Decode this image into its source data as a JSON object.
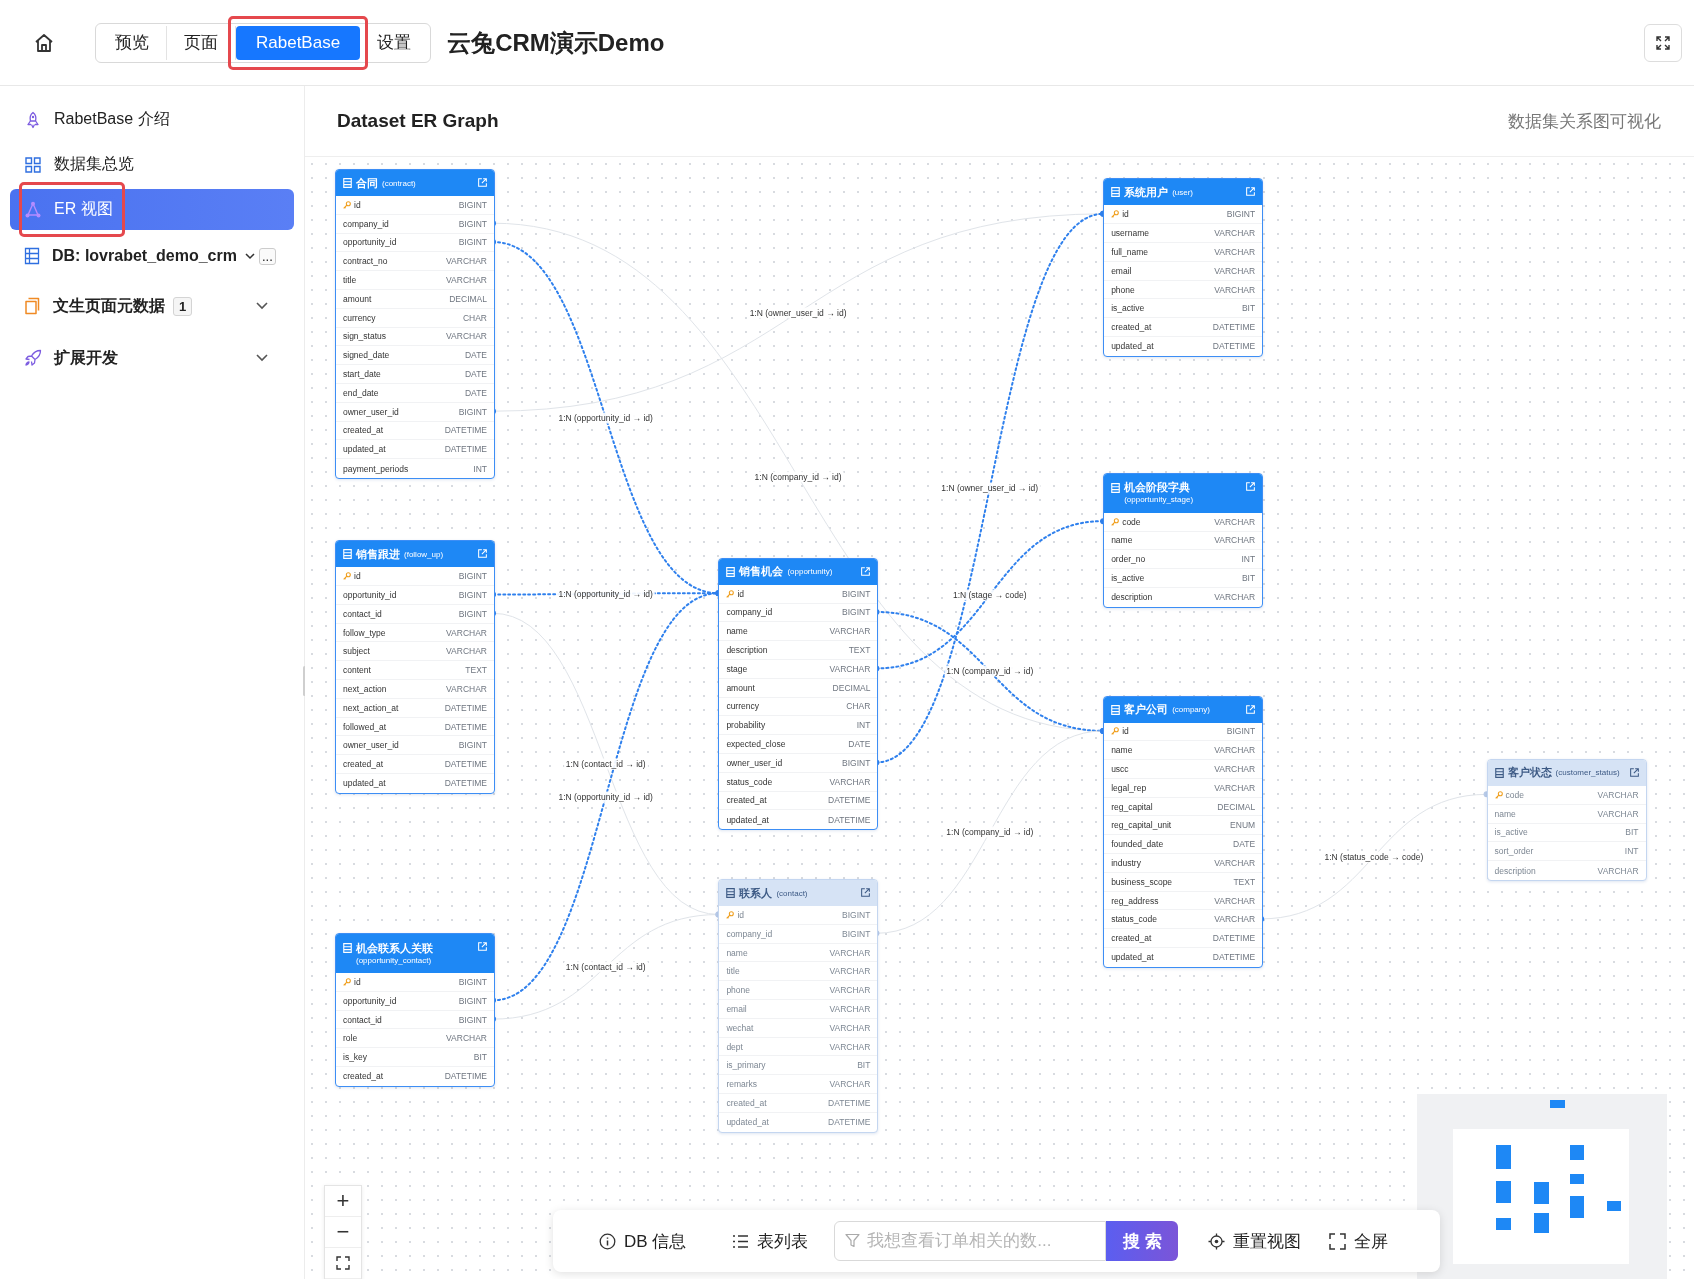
{
  "topbar": {
    "tabs": [
      {
        "label": "预览",
        "selected": false,
        "annotated": false
      },
      {
        "label": "页面",
        "selected": false,
        "annotated": false
      },
      {
        "label": "RabetBase",
        "selected": true,
        "annotated": true
      },
      {
        "label": "设置",
        "selected": false,
        "annotated": false
      }
    ],
    "title": "云兔CRM演示Demo"
  },
  "sidebar": {
    "items": [
      {
        "kind": "link",
        "label": "RabetBase 介绍",
        "selected": false,
        "annotated": false
      },
      {
        "kind": "link",
        "label": "数据集总览",
        "selected": false,
        "annotated": false
      },
      {
        "kind": "link",
        "label": "ER 视图",
        "selected": true,
        "annotated": true
      },
      {
        "kind": "db",
        "label": "DB: lovrabet_demo_crm",
        "more": "..."
      },
      {
        "kind": "group",
        "label": "文生页面元数据",
        "badge": "1",
        "expanded": false
      },
      {
        "kind": "group",
        "label": "扩展开发",
        "expanded": false
      }
    ]
  },
  "panel": {
    "title": "Dataset ER Graph",
    "subtitle": "数据集关系图可视化"
  },
  "tables": [
    {
      "title": "合同",
      "name": "(contract)",
      "faded": false,
      "fields": [
        {
          "name": "id",
          "type": "BIGINT",
          "pk": true
        },
        {
          "name": "company_id",
          "type": "BIGINT",
          "pk": false
        },
        {
          "name": "opportunity_id",
          "type": "BIGINT",
          "pk": false
        },
        {
          "name": "contract_no",
          "type": "VARCHAR",
          "pk": false
        },
        {
          "name": "title",
          "type": "VARCHAR",
          "pk": false
        },
        {
          "name": "amount",
          "type": "DECIMAL",
          "pk": false
        },
        {
          "name": "currency",
          "type": "CHAR",
          "pk": false
        },
        {
          "name": "sign_status",
          "type": "VARCHAR",
          "pk": false
        },
        {
          "name": "signed_date",
          "type": "DATE",
          "pk": false
        },
        {
          "name": "start_date",
          "type": "DATE",
          "pk": false
        },
        {
          "name": "end_date",
          "type": "DATE",
          "pk": false
        },
        {
          "name": "owner_user_id",
          "type": "BIGINT",
          "pk": false
        },
        {
          "name": "created_at",
          "type": "DATETIME",
          "pk": false
        },
        {
          "name": "updated_at",
          "type": "DATETIME",
          "pk": false
        },
        {
          "name": "payment_periods",
          "type": "INT",
          "pk": false
        }
      ]
    },
    {
      "title": "销售跟进",
      "name": "(follow_up)",
      "faded": false,
      "fields": [
        {
          "name": "id",
          "type": "BIGINT",
          "pk": true
        },
        {
          "name": "opportunity_id",
          "type": "BIGINT",
          "pk": false
        },
        {
          "name": "contact_id",
          "type": "BIGINT",
          "pk": false
        },
        {
          "name": "follow_type",
          "type": "VARCHAR",
          "pk": false
        },
        {
          "name": "subject",
          "type": "VARCHAR",
          "pk": false
        },
        {
          "name": "content",
          "type": "TEXT",
          "pk": false
        },
        {
          "name": "next_action",
          "type": "VARCHAR",
          "pk": false
        },
        {
          "name": "next_action_at",
          "type": "DATETIME",
          "pk": false
        },
        {
          "name": "followed_at",
          "type": "DATETIME",
          "pk": false
        },
        {
          "name": "owner_user_id",
          "type": "BIGINT",
          "pk": false
        },
        {
          "name": "created_at",
          "type": "DATETIME",
          "pk": false
        },
        {
          "name": "updated_at",
          "type": "DATETIME",
          "pk": false
        }
      ]
    },
    {
      "title": "机会联系人关联",
      "name": "(opportunity_contact)",
      "faded": false,
      "fields": [
        {
          "name": "id",
          "type": "BIGINT",
          "pk": true
        },
        {
          "name": "opportunity_id",
          "type": "BIGINT",
          "pk": false
        },
        {
          "name": "contact_id",
          "type": "BIGINT",
          "pk": false
        },
        {
          "name": "role",
          "type": "VARCHAR",
          "pk": false
        },
        {
          "name": "is_key",
          "type": "BIT",
          "pk": false
        },
        {
          "name": "created_at",
          "type": "DATETIME",
          "pk": false
        }
      ]
    },
    {
      "title": "销售机会",
      "name": "(opportunity)",
      "faded": false,
      "fields": [
        {
          "name": "id",
          "type": "BIGINT",
          "pk": true
        },
        {
          "name": "company_id",
          "type": "BIGINT",
          "pk": false
        },
        {
          "name": "name",
          "type": "VARCHAR",
          "pk": false
        },
        {
          "name": "description",
          "type": "TEXT",
          "pk": false
        },
        {
          "name": "stage",
          "type": "VARCHAR",
          "pk": false
        },
        {
          "name": "amount",
          "type": "DECIMAL",
          "pk": false
        },
        {
          "name": "currency",
          "type": "CHAR",
          "pk": false
        },
        {
          "name": "probability",
          "type": "INT",
          "pk": false
        },
        {
          "name": "expected_close",
          "type": "DATE",
          "pk": false
        },
        {
          "name": "owner_user_id",
          "type": "BIGINT",
          "pk": false
        },
        {
          "name": "status_code",
          "type": "VARCHAR",
          "pk": false
        },
        {
          "name": "created_at",
          "type": "DATETIME",
          "pk": false
        },
        {
          "name": "updated_at",
          "type": "DATETIME",
          "pk": false
        }
      ]
    },
    {
      "title": "联系人",
      "name": "(contact)",
      "faded": true,
      "fields": [
        {
          "name": "id",
          "type": "BIGINT",
          "pk": true
        },
        {
          "name": "company_id",
          "type": "BIGINT",
          "pk": false
        },
        {
          "name": "name",
          "type": "VARCHAR",
          "pk": false
        },
        {
          "name": "title",
          "type": "VARCHAR",
          "pk": false
        },
        {
          "name": "phone",
          "type": "VARCHAR",
          "pk": false
        },
        {
          "name": "email",
          "type": "VARCHAR",
          "pk": false
        },
        {
          "name": "wechat",
          "type": "VARCHAR",
          "pk": false
        },
        {
          "name": "dept",
          "type": "VARCHAR",
          "pk": false
        },
        {
          "name": "is_primary",
          "type": "BIT",
          "pk": false
        },
        {
          "name": "remarks",
          "type": "VARCHAR",
          "pk": false
        },
        {
          "name": "created_at",
          "type": "DATETIME",
          "pk": false
        },
        {
          "name": "updated_at",
          "type": "DATETIME",
          "pk": false
        }
      ]
    },
    {
      "title": "系统用户",
      "name": "(user)",
      "faded": false,
      "fields": [
        {
          "name": "id",
          "type": "BIGINT",
          "pk": true
        },
        {
          "name": "username",
          "type": "VARCHAR",
          "pk": false
        },
        {
          "name": "full_name",
          "type": "VARCHAR",
          "pk": false
        },
        {
          "name": "email",
          "type": "VARCHAR",
          "pk": false
        },
        {
          "name": "phone",
          "type": "VARCHAR",
          "pk": false
        },
        {
          "name": "is_active",
          "type": "BIT",
          "pk": false
        },
        {
          "name": "created_at",
          "type": "DATETIME",
          "pk": false
        },
        {
          "name": "updated_at",
          "type": "DATETIME",
          "pk": false
        }
      ]
    },
    {
      "title": "机会阶段字典",
      "name": "(opportunity_stage)",
      "faded": false,
      "fields": [
        {
          "name": "code",
          "type": "VARCHAR",
          "pk": true
        },
        {
          "name": "name",
          "type": "VARCHAR",
          "pk": false
        },
        {
          "name": "order_no",
          "type": "INT",
          "pk": false
        },
        {
          "name": "is_active",
          "type": "BIT",
          "pk": false
        },
        {
          "name": "description",
          "type": "VARCHAR",
          "pk": false
        }
      ]
    },
    {
      "title": "客户公司",
      "name": "(company)",
      "faded": false,
      "fields": [
        {
          "name": "id",
          "type": "BIGINT",
          "pk": true
        },
        {
          "name": "name",
          "type": "VARCHAR",
          "pk": false
        },
        {
          "name": "uscc",
          "type": "VARCHAR",
          "pk": false
        },
        {
          "name": "legal_rep",
          "type": "VARCHAR",
          "pk": false
        },
        {
          "name": "reg_capital",
          "type": "DECIMAL",
          "pk": false
        },
        {
          "name": "reg_capital_unit",
          "type": "ENUM",
          "pk": false
        },
        {
          "name": "founded_date",
          "type": "DATE",
          "pk": false
        },
        {
          "name": "industry",
          "type": "VARCHAR",
          "pk": false
        },
        {
          "name": "business_scope",
          "type": "TEXT",
          "pk": false
        },
        {
          "name": "reg_address",
          "type": "VARCHAR",
          "pk": false
        },
        {
          "name": "status_code",
          "type": "VARCHAR",
          "pk": false
        },
        {
          "name": "created_at",
          "type": "DATETIME",
          "pk": false
        },
        {
          "name": "updated_at",
          "type": "DATETIME",
          "pk": false
        }
      ]
    },
    {
      "title": "客户状态",
      "name": "(customer_status)",
      "faded": true,
      "fields": [
        {
          "name": "code",
          "type": "VARCHAR",
          "pk": true
        },
        {
          "name": "name",
          "type": "VARCHAR",
          "pk": false
        },
        {
          "name": "is_active",
          "type": "BIT",
          "pk": false
        },
        {
          "name": "sort_order",
          "type": "INT",
          "pk": false
        },
        {
          "name": "description",
          "type": "VARCHAR",
          "pk": false
        }
      ]
    }
  ],
  "relations": [
    {
      "label": "1:N (owner_user_id → id)",
      "highlighted": false
    },
    {
      "label": "1:N (opportunity_id → id)",
      "highlighted": true
    },
    {
      "label": "1:N (company_id → id)",
      "highlighted": false
    },
    {
      "label": "1:N (owner_user_id → id)",
      "highlighted": true
    },
    {
      "label": "1:N (opportunity_id → id)",
      "highlighted": true
    },
    {
      "label": "1:N (stage → code)",
      "highlighted": true
    },
    {
      "label": "1:N (company_id → id)",
      "highlighted": true
    },
    {
      "label": "1:N (contact_id → id)",
      "highlighted": false
    },
    {
      "label": "1:N (opportunity_id → id)",
      "highlighted": true
    },
    {
      "label": "1:N (company_id → id)",
      "highlighted": false
    },
    {
      "label": "1:N (status_code → code)",
      "highlighted": false
    },
    {
      "label": "1:N (contact_id → id)",
      "highlighted": false
    }
  ],
  "zoom_controls": [
    "+",
    "−"
  ],
  "toolbar": {
    "db_info": "DB 信息",
    "table_list": "表列表",
    "search_placeholder": "我想查看订单相关的数...",
    "search_button": "搜 索",
    "reset_view": "重置视图",
    "fullscreen": "全屏"
  }
}
